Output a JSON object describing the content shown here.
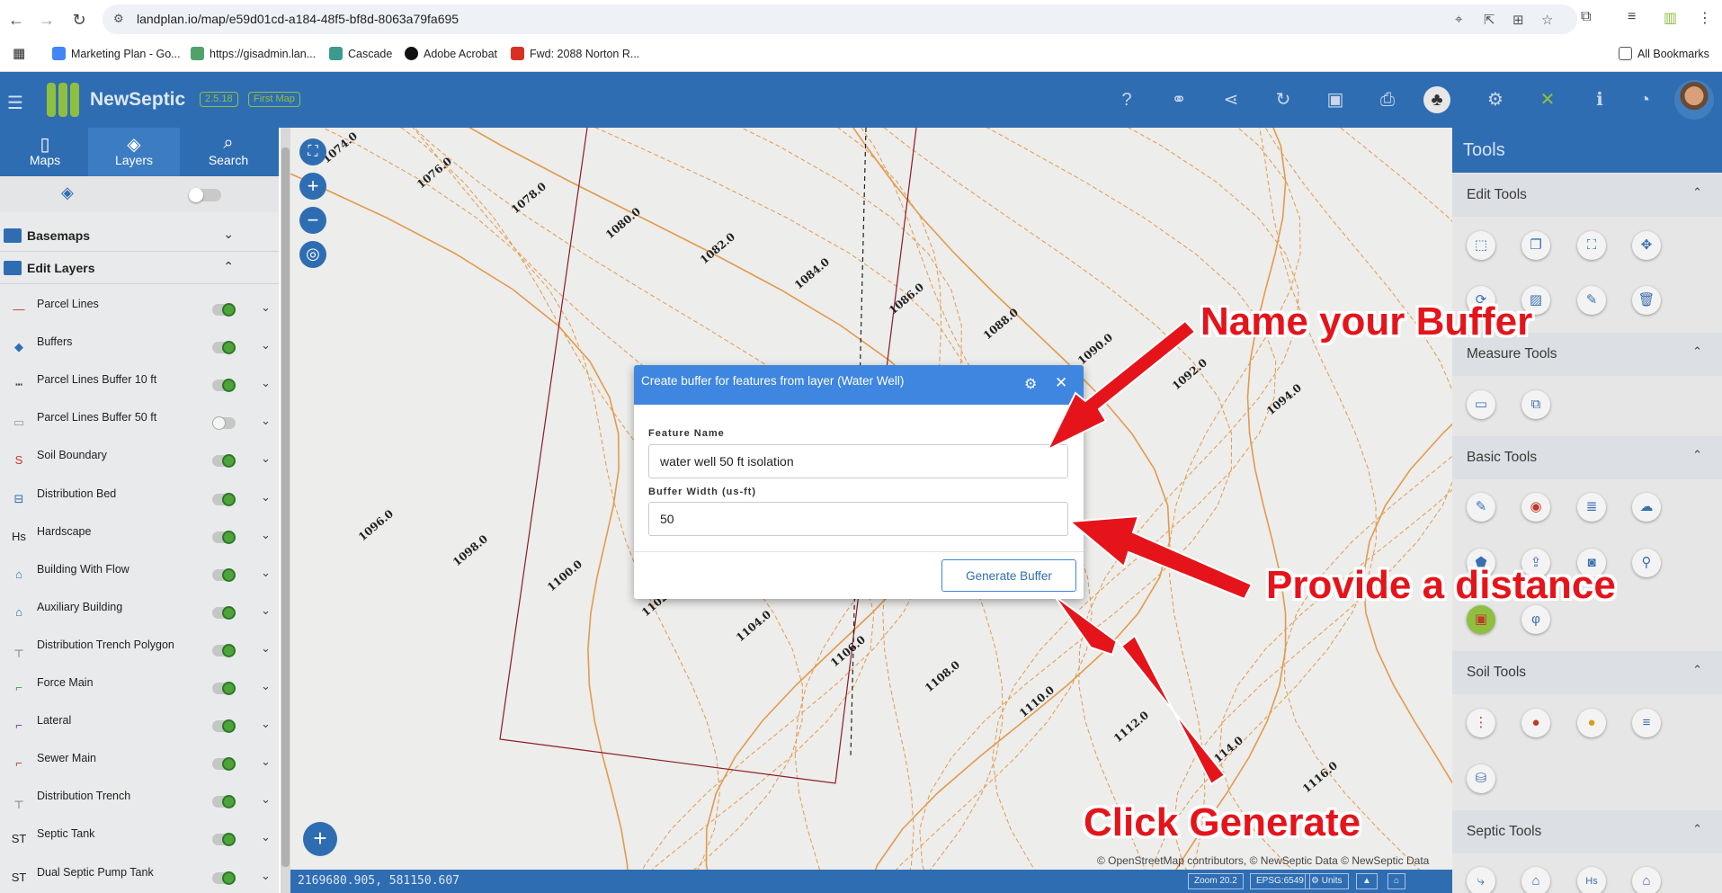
{
  "browser": {
    "url": "landplan.io/map/e59d01cd-a184-48f5-bf8d-8063a79fa695",
    "bookmarks": [
      "Marketing Plan - Go...",
      "https://gisadmin.lan...",
      "Cascade",
      "Adobe Acrobat",
      "Fwd: 2088 Norton R..."
    ],
    "all_bookmarks": "All Bookmarks"
  },
  "app": {
    "name": "NewSeptic",
    "version": "2.5.18",
    "map_name": "First Map"
  },
  "left_tabs": [
    "Maps",
    "Layers",
    "Search"
  ],
  "groups": {
    "basemaps": "Basemaps",
    "edit_layers": "Edit Layers"
  },
  "layers": [
    {
      "label": "Parcel Lines",
      "on": true
    },
    {
      "label": "Buffers",
      "on": true
    },
    {
      "label": "Parcel Lines Buffer 10 ft",
      "on": true
    },
    {
      "label": "Parcel Lines Buffer 50 ft",
      "on": false
    },
    {
      "label": "Soil Boundary",
      "on": true
    },
    {
      "label": "Distribution Bed",
      "on": true
    },
    {
      "label": "Hardscape",
      "on": true
    },
    {
      "label": "Building With Flow",
      "on": true
    },
    {
      "label": "Auxiliary Building",
      "on": true
    },
    {
      "label": "Distribution Trench Polygon",
      "on": true
    },
    {
      "label": "Force Main",
      "on": true
    },
    {
      "label": "Lateral",
      "on": true
    },
    {
      "label": "Sewer Main",
      "on": true
    },
    {
      "label": "Distribution Trench",
      "on": true
    },
    {
      "label": "Septic Tank",
      "on": true
    },
    {
      "label": "Dual Septic Pump Tank",
      "on": true
    }
  ],
  "dialog": {
    "title": "Create buffer for features from layer (Water Well)",
    "feature_name_label": "Feature Name",
    "feature_name_value": "water well 50 ft isolation",
    "buffer_width_label": "Buffer Width (us-ft)",
    "buffer_width_value": "50",
    "generate_label": "Generate Buffer"
  },
  "tools_panel": {
    "title": "Tools",
    "sections": [
      "Edit Tools",
      "Measure Tools",
      "Basic Tools",
      "Soil Tools",
      "Septic Tools"
    ]
  },
  "status": {
    "coords": "2169680.905, 581150.607",
    "zoom": "Zoom 20.2",
    "epsg": "EPSG:6549",
    "units": "Units",
    "attribution": "© OpenStreetMap contributors, © NewSeptic Data © NewSeptic Data"
  },
  "contour_labels": [
    "1074.0",
    "1076.0",
    "1078.0",
    "1080.0",
    "1082.0",
    "1084.0",
    "1086.0",
    "1088.0",
    "1090.0",
    "1092.0",
    "1094.0",
    "1096.0",
    "1098.0",
    "1100.0",
    "1102.0",
    "1104.0",
    "1106.0",
    "1108.0",
    "1110.0",
    "1112.0",
    "1114.0",
    "1116.0"
  ],
  "callouts": {
    "name": "Name your Buffer",
    "distance": "Provide a distance",
    "generate": "Click Generate"
  },
  "colors": {
    "primary": "#2f6db3",
    "dialog_header": "#3e86df",
    "callout": "#e5141b",
    "contour": "#e39a4e",
    "parcel": "#8b1a2b",
    "toggle_on": "#4ea33a"
  }
}
